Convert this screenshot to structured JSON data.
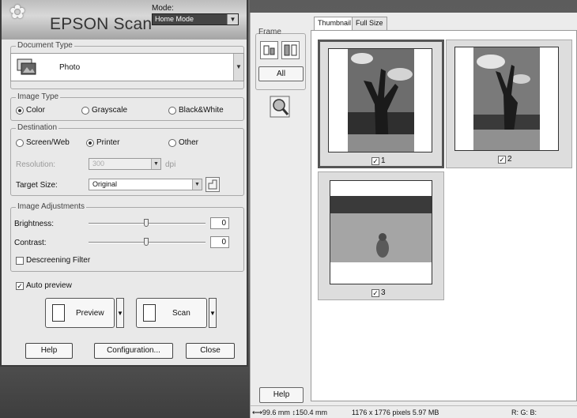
{
  "app": {
    "title": "EPSON Scan",
    "mode_label": "Mode:",
    "mode_value": "Home Mode"
  },
  "document_type": {
    "legend": "Document Type",
    "value": "Photo"
  },
  "image_type": {
    "legend": "Image Type",
    "options": [
      "Color",
      "Grayscale",
      "Black&White"
    ],
    "selected": "Color"
  },
  "destination": {
    "legend": "Destination",
    "options": [
      "Screen/Web",
      "Printer",
      "Other"
    ],
    "selected": "Printer",
    "resolution_label": "Resolution:",
    "resolution_value": "300",
    "resolution_unit": "dpi",
    "target_size_label": "Target Size:",
    "target_size_value": "Original"
  },
  "adjustments": {
    "legend": "Image Adjustments",
    "brightness_label": "Brightness:",
    "brightness_value": "0",
    "contrast_label": "Contrast:",
    "contrast_value": "0",
    "descreening_label": "Descreening Filter",
    "descreening_checked": false
  },
  "auto_preview": {
    "label": "Auto preview",
    "checked": true
  },
  "buttons": {
    "preview": "Preview",
    "scan": "Scan",
    "help": "Help",
    "configuration": "Configuration...",
    "close": "Close"
  },
  "preview_panel": {
    "frame_label": "Frame",
    "all_label": "All",
    "help_label": "Help",
    "tabs": [
      "Thumbnail",
      "Full Size"
    ],
    "active_tab": "Thumbnail",
    "thumbnails": [
      {
        "number": "1",
        "checked": true,
        "selected": true
      },
      {
        "number": "2",
        "checked": true,
        "selected": false
      },
      {
        "number": "3",
        "checked": true,
        "selected": false
      }
    ]
  },
  "status": {
    "width_value": "99.6 mm",
    "height_value": "150.4 mm",
    "pixels": "1176 x 1776 pixels 5.97 MB",
    "rgb": "R: G: B:"
  },
  "colors": {
    "title_band": "#bdbdbd",
    "window_bg": "#e9e9e9",
    "mode_select_bg": "#444444"
  },
  "icons": [
    "epson-flower-icon",
    "photo-doc-icon",
    "dropdown-arrow-icon",
    "preview-doc-icon",
    "scan-doc-icon",
    "frame-rotate-icon",
    "frame-flip-icon",
    "zoom-icon"
  ]
}
